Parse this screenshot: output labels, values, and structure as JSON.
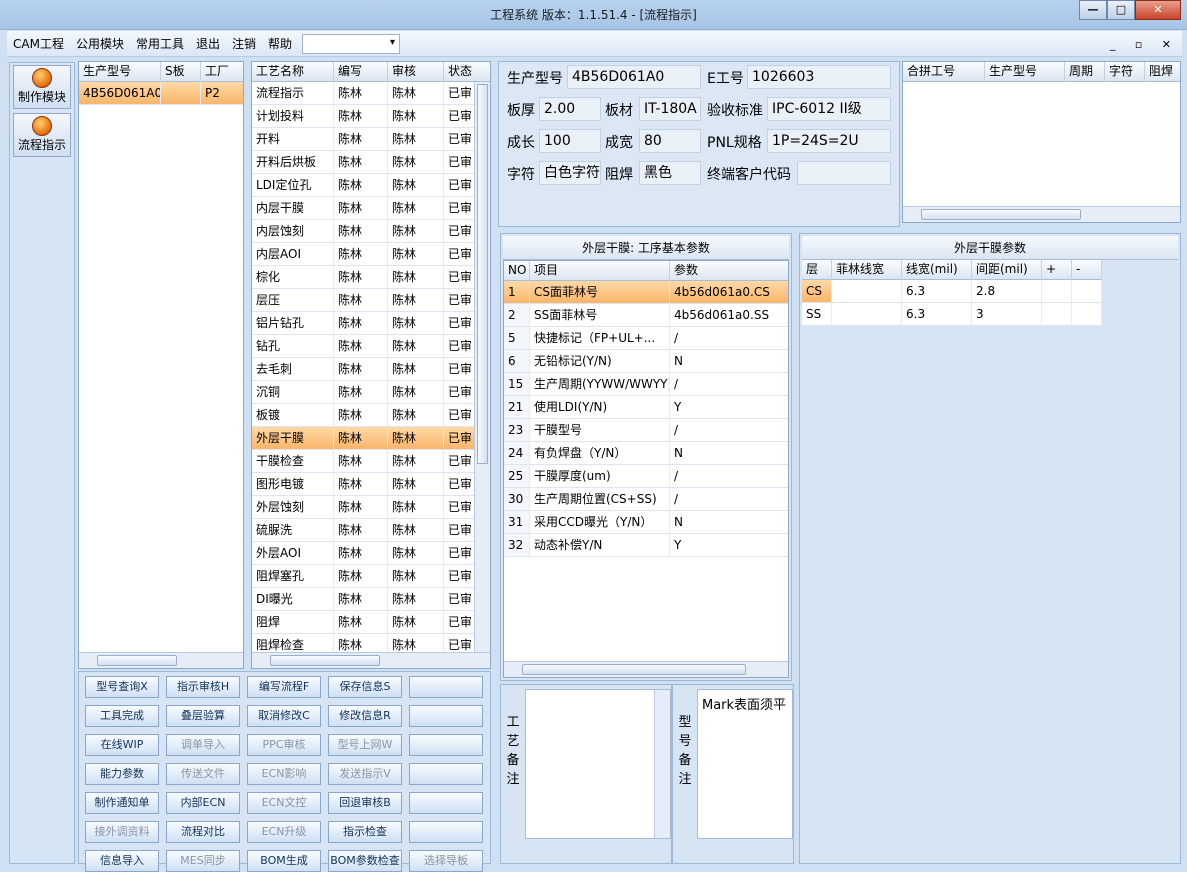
{
  "window": {
    "title": "工程系统  版本：1.1.51.4 - [流程指示]",
    "minimize": "—",
    "maximize": "□",
    "close": "✕"
  },
  "menu": [
    "CAM工程",
    "公用模块",
    "常用工具",
    "退出",
    "注销",
    "帮助"
  ],
  "mdi_controls": "_ ▫ ✕",
  "nav": [
    {
      "label": "制作模块",
      "icon": "fire-icon"
    },
    {
      "label": "流程指示",
      "icon": "flow-icon"
    }
  ],
  "model_grid": {
    "headers": [
      "生产型号",
      "S板",
      "工厂"
    ],
    "rows": [
      [
        "4B56D061A0",
        "",
        "P2"
      ]
    ]
  },
  "process_grid": {
    "headers": [
      "工艺名称",
      "编写",
      "审核",
      "状态"
    ],
    "selected_index": 15,
    "rows": [
      [
        "流程指示",
        "陈林",
        "陈林",
        "已审"
      ],
      [
        "计划投料",
        "陈林",
        "陈林",
        "已审"
      ],
      [
        "开料",
        "陈林",
        "陈林",
        "已审"
      ],
      [
        "开料后烘板",
        "陈林",
        "陈林",
        "已审"
      ],
      [
        "LDI定位孔",
        "陈林",
        "陈林",
        "已审"
      ],
      [
        "内层干膜",
        "陈林",
        "陈林",
        "已审"
      ],
      [
        "内层蚀刻",
        "陈林",
        "陈林",
        "已审"
      ],
      [
        "内层AOI",
        "陈林",
        "陈林",
        "已审"
      ],
      [
        "棕化",
        "陈林",
        "陈林",
        "已审"
      ],
      [
        "层压",
        "陈林",
        "陈林",
        "已审"
      ],
      [
        "铝片钻孔",
        "陈林",
        "陈林",
        "已审"
      ],
      [
        "钻孔",
        "陈林",
        "陈林",
        "已审"
      ],
      [
        "去毛刺",
        "陈林",
        "陈林",
        "已审"
      ],
      [
        "沉铜",
        "陈林",
        "陈林",
        "已审"
      ],
      [
        "板镀",
        "陈林",
        "陈林",
        "已审"
      ],
      [
        "外层干膜",
        "陈林",
        "陈林",
        "已审"
      ],
      [
        "干膜检查",
        "陈林",
        "陈林",
        "已审"
      ],
      [
        "图形电镀",
        "陈林",
        "陈林",
        "已审"
      ],
      [
        "外层蚀刻",
        "陈林",
        "陈林",
        "已审"
      ],
      [
        "硫脲洗",
        "陈林",
        "陈林",
        "已审"
      ],
      [
        "外层AOI",
        "陈林",
        "陈林",
        "已审"
      ],
      [
        "阻焊塞孔",
        "陈林",
        "陈林",
        "已审"
      ],
      [
        "DI曝光",
        "陈林",
        "陈林",
        "已审"
      ],
      [
        "阻焊",
        "陈林",
        "陈林",
        "已审"
      ],
      [
        "阻焊检查",
        "陈林",
        "陈林",
        "已审"
      ]
    ]
  },
  "buttons": [
    [
      {
        "t": "型号查询X",
        "d": false
      },
      {
        "t": "指示审核H",
        "d": false
      },
      {
        "t": "编写流程F",
        "d": false
      },
      {
        "t": "保存信息S",
        "d": false
      },
      {
        "t": "",
        "d": false
      }
    ],
    [
      {
        "t": "工具完成",
        "d": false
      },
      {
        "t": "叠层验算",
        "d": false
      },
      {
        "t": "取消修改C",
        "d": false
      },
      {
        "t": "修改信息R",
        "d": false
      },
      {
        "t": "",
        "d": false
      }
    ],
    [
      {
        "t": "在线WIP",
        "d": false
      },
      {
        "t": "调单导入",
        "d": true
      },
      {
        "t": "PPC审核",
        "d": true
      },
      {
        "t": "型号上网W",
        "d": true
      },
      {
        "t": "",
        "d": false
      }
    ],
    [
      {
        "t": "能力参数",
        "d": false
      },
      {
        "t": "传送文件",
        "d": true
      },
      {
        "t": "ECN影响",
        "d": true
      },
      {
        "t": "发送指示V",
        "d": true
      },
      {
        "t": "",
        "d": false
      }
    ],
    [
      {
        "t": "制作通知单",
        "d": false
      },
      {
        "t": "内部ECN",
        "d": false
      },
      {
        "t": "ECN文控",
        "d": true
      },
      {
        "t": "回退审核B",
        "d": false
      },
      {
        "t": "",
        "d": false
      }
    ],
    [
      {
        "t": "接外调资料",
        "d": true
      },
      {
        "t": "流程对比",
        "d": false
      },
      {
        "t": "ECN升级",
        "d": true
      },
      {
        "t": "指示检查",
        "d": false
      },
      {
        "t": "",
        "d": false
      }
    ],
    [
      {
        "t": "信息导入",
        "d": false
      },
      {
        "t": "MES同步",
        "d": true
      },
      {
        "t": "BOM生成",
        "d": false
      },
      {
        "t": "BOM参数检查",
        "d": false
      },
      {
        "t": "选择导板",
        "d": true
      }
    ]
  ],
  "info": {
    "model_label": "生产型号",
    "model_value": "4B56D061A0",
    "eno_label": "E工号",
    "eno_value": "1026603",
    "thick_label": "板厚",
    "thick_value": "2.00",
    "material_label": "板材",
    "material_value": "IT-180A",
    "standard_label": "验收标准",
    "standard_value": "IPC-6012 II级",
    "len_label": "成长",
    "len_value": "100",
    "wid_label": "成宽",
    "wid_value": "80",
    "pnl_label": "PNL规格",
    "pnl_value": "1P=24S=2U",
    "char_label": "字符",
    "char_value": "白色字符",
    "mask_label": "阻焊",
    "mask_value": "黑色",
    "cust_label": "终端客户代码",
    "cust_value": ""
  },
  "merge_grid": {
    "headers": [
      "合拼工号",
      "生产型号",
      "周期",
      "字符",
      "阻焊"
    ]
  },
  "params_panel": {
    "title": "外层干膜: 工序基本参数",
    "headers": [
      "NO",
      "项目",
      "参数"
    ],
    "rows": [
      [
        "1",
        "CS面菲林号",
        "4b56d061a0.CS"
      ],
      [
        "2",
        "SS面菲林号",
        "4b56d061a0.SS"
      ],
      [
        "5",
        "快捷标记（FP+UL+...",
        "/"
      ],
      [
        "6",
        "无铅标记(Y/N)",
        "N"
      ],
      [
        "15",
        "生产周期(YYWW/WWYY)",
        "/"
      ],
      [
        "21",
        "使用LDI(Y/N)",
        "Y"
      ],
      [
        "23",
        "干膜型号",
        "/"
      ],
      [
        "24",
        "有负焊盘（Y/N）",
        "N"
      ],
      [
        "25",
        "干膜厚度(um)",
        "/"
      ],
      [
        "30",
        "生产周期位置(CS+SS)",
        "/"
      ],
      [
        "31",
        "采用CCD曝光（Y/N）",
        "N"
      ],
      [
        "32",
        "动态补偿Y/N",
        "Y"
      ]
    ]
  },
  "film_panel": {
    "title": "外层干膜参数",
    "headers": [
      "层",
      "菲林线宽",
      "线宽(mil)",
      "间距(mil)",
      "+",
      "-"
    ],
    "rows": [
      [
        "CS",
        "",
        "6.3",
        "2.8",
        "",
        ""
      ],
      [
        "SS",
        "",
        "6.3",
        "3",
        "",
        ""
      ]
    ]
  },
  "process_note_label": "工艺备注",
  "model_note_label": "型号备注",
  "model_note_text": "Mark表面须平"
}
